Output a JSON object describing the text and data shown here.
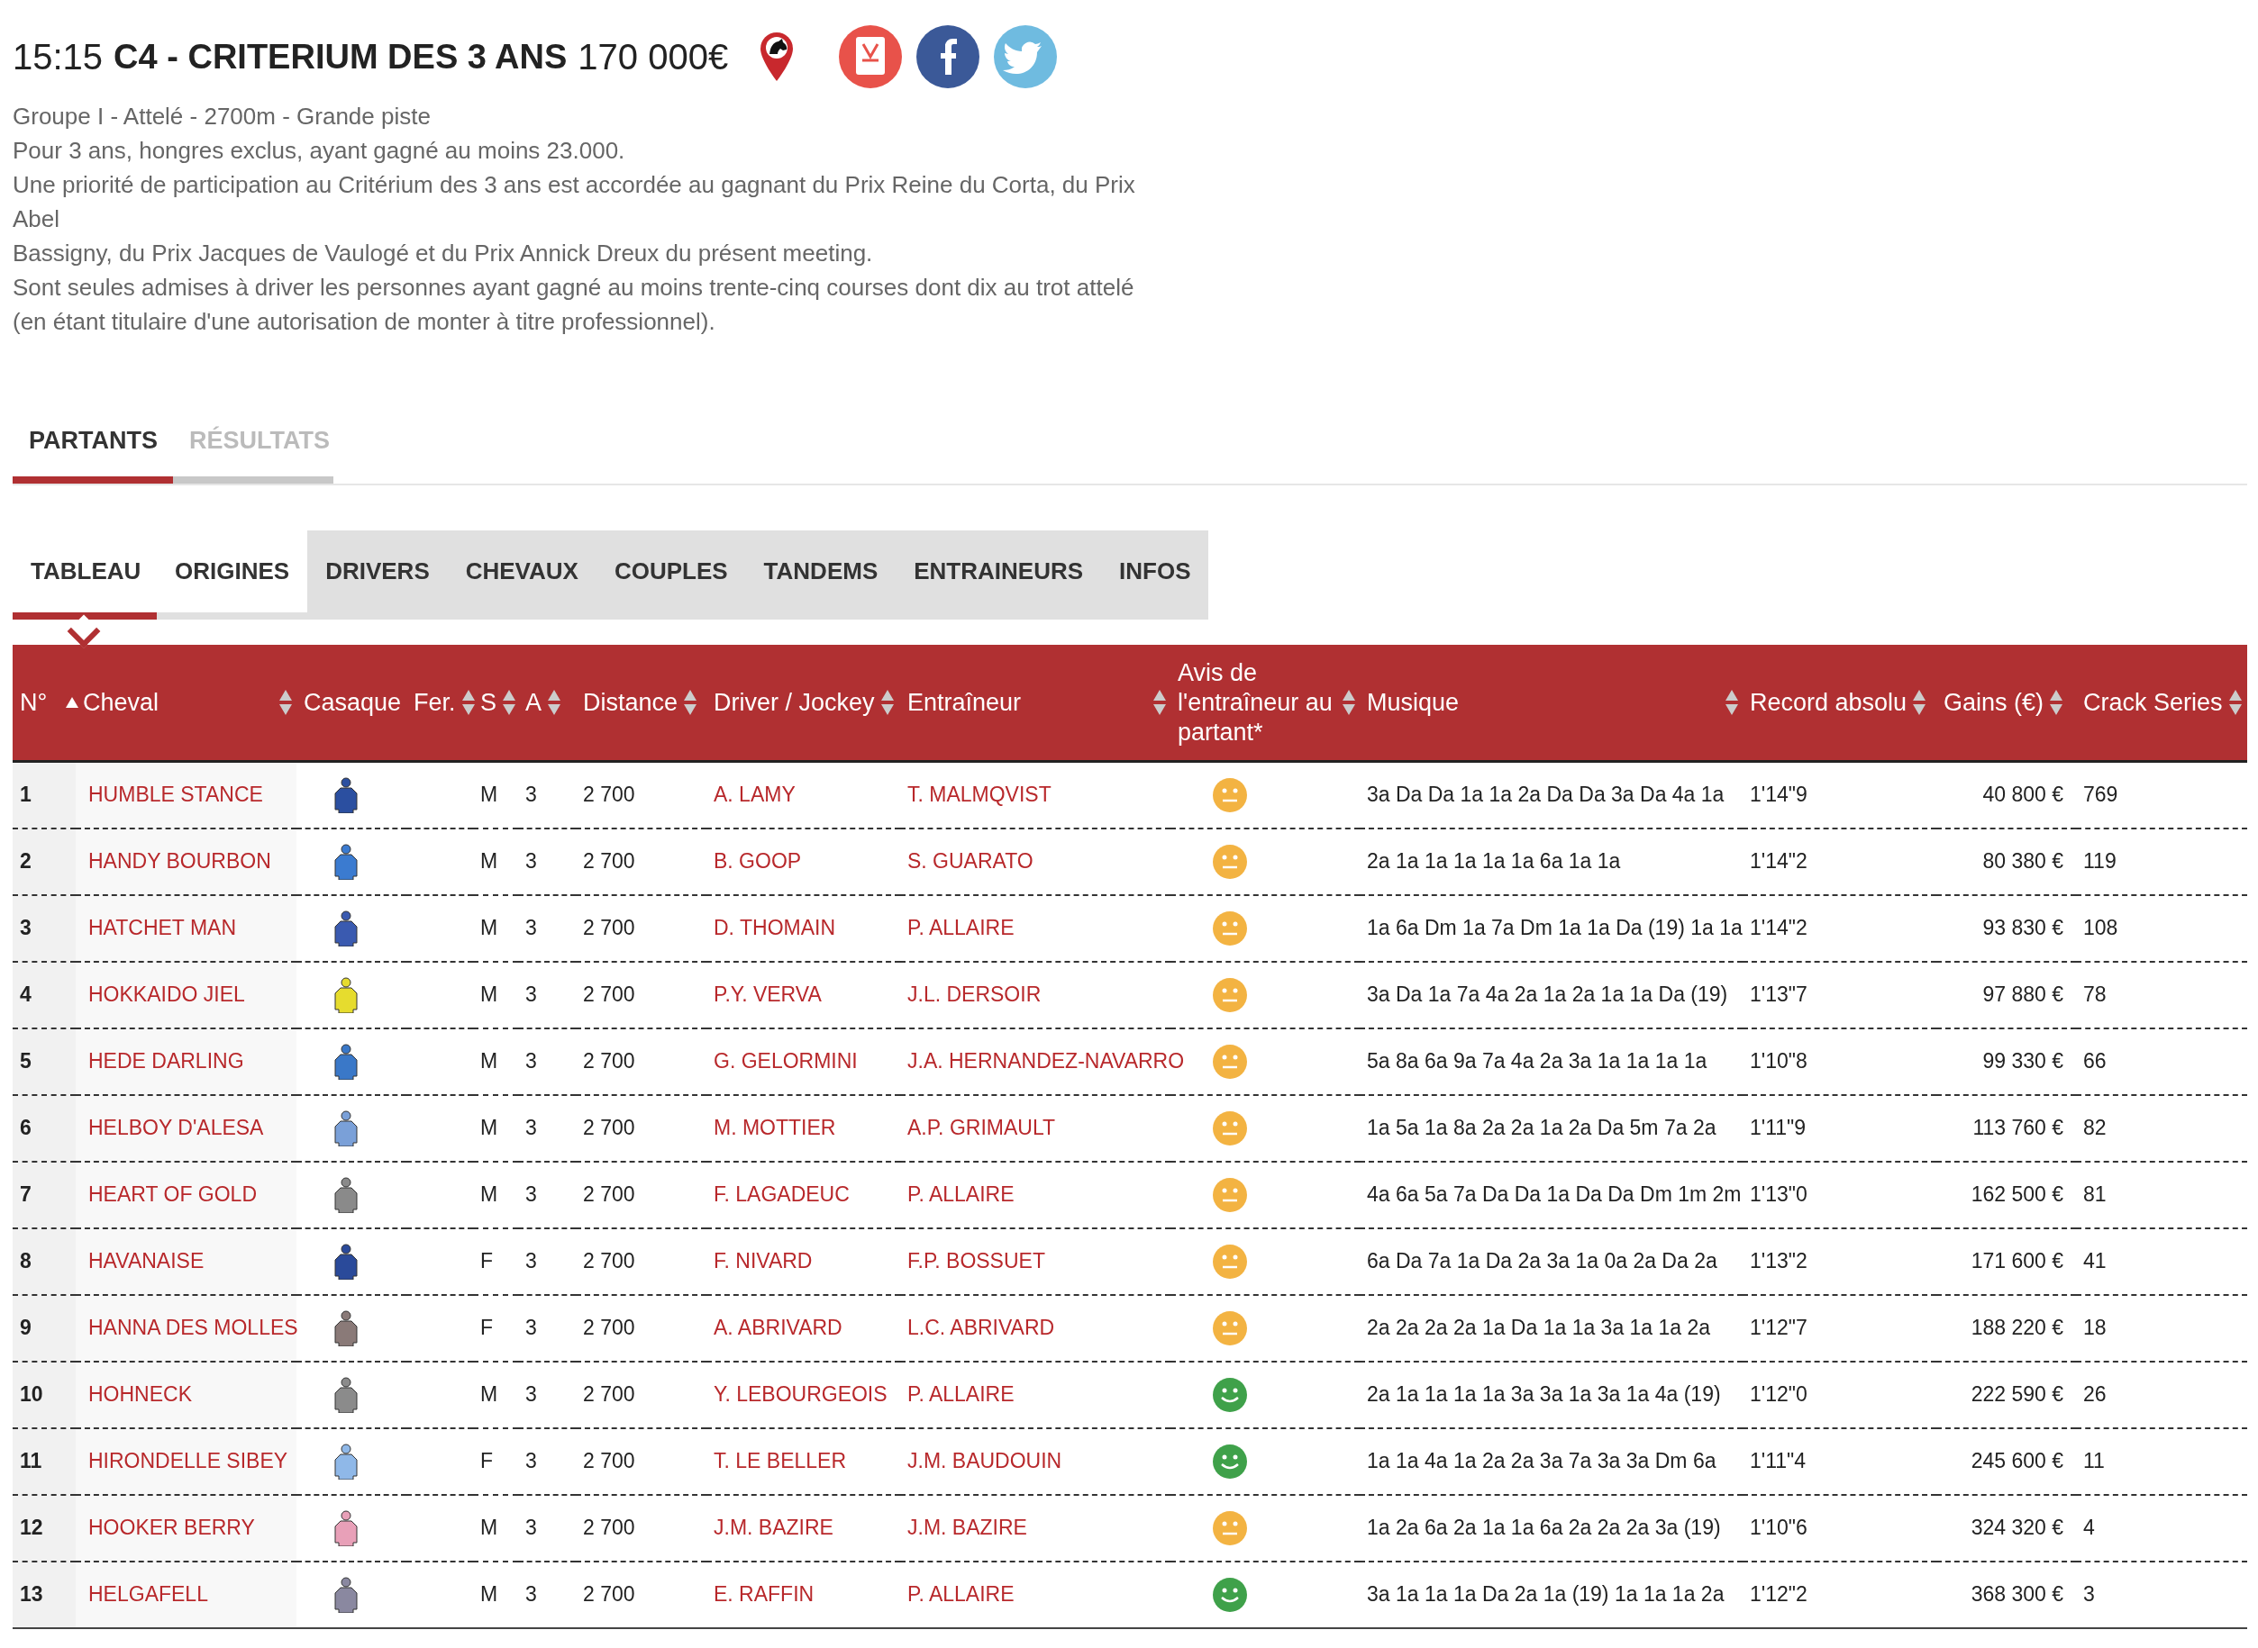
{
  "race": {
    "time": "15:15",
    "title": "C4 - CRITERIUM DES 3 ANS",
    "prize": "170 000€"
  },
  "description": [
    "Groupe I - Attelé - 2700m - Grande piste",
    "Pour 3 ans, hongres exclus, ayant gagné au moins 23.000.",
    "Une priorité de participation au Critérium des 3 ans est accordée au gagnant du Prix Reine du Corta, du Prix",
    "Abel",
    "Bassigny, du Prix Jacques de Vaulogé et du Prix Annick Dreux du présent meeting.",
    "Sont seules admises à driver les personnes ayant gagné au moins trente-cinq courses dont dix au trot attelé",
    "(en étant titulaire d'une autorisation de monter à titre professionnel)."
  ],
  "tabs": [
    {
      "label": "PARTANTS",
      "selected": true
    },
    {
      "label": "RÉSULTATS",
      "selected": false
    }
  ],
  "subtabs": [
    {
      "label": "TABLEAU",
      "selected": true,
      "shaded": false
    },
    {
      "label": "ORIGINES",
      "selected": false,
      "shaded": false
    },
    {
      "label": "DRIVERS",
      "selected": false,
      "shaded": true
    },
    {
      "label": "CHEVAUX",
      "selected": false,
      "shaded": true
    },
    {
      "label": "COUPLES",
      "selected": false,
      "shaded": true
    },
    {
      "label": "TANDEMS",
      "selected": false,
      "shaded": true
    },
    {
      "label": "ENTRAINEURS",
      "selected": false,
      "shaded": true
    },
    {
      "label": "INFOS",
      "selected": false,
      "shaded": true
    }
  ],
  "table": {
    "columns": [
      {
        "label": "N°",
        "sortable": true,
        "sorted_ascending": true
      },
      {
        "label": "Cheval",
        "sortable": true,
        "sorted_ascending": false
      },
      {
        "label": "Casaque",
        "sortable": false
      },
      {
        "label": "Fer.",
        "sortable": true,
        "sorted_ascending": false
      },
      {
        "label": "S",
        "sortable": true,
        "sorted_ascending": false
      },
      {
        "label": "A",
        "sortable": true,
        "sorted_ascending": false
      },
      {
        "label": "Distance",
        "sortable": true,
        "sorted_ascending": false
      },
      {
        "label": "Driver / Jockey",
        "sortable": true,
        "sorted_ascending": false
      },
      {
        "label": "Entraîneur",
        "sortable": true,
        "sorted_ascending": false
      },
      {
        "label": "Avis de l'entraîneur au partant*",
        "sortable": true,
        "sorted_ascending": false
      },
      {
        "label": "Musique",
        "sortable": true,
        "sorted_ascending": false
      },
      {
        "label": "Record absolu",
        "sortable": true,
        "sorted_ascending": false
      },
      {
        "label": "Gains (€)",
        "sortable": true,
        "sorted_ascending": false
      },
      {
        "label": "Crack Series",
        "sortable": true,
        "sorted_ascending": false
      }
    ],
    "rows": [
      {
        "num": "1",
        "horse": "HUMBLE STANCE",
        "color": "#2b4fa0",
        "sex": "M",
        "age": "3",
        "distance": "2 700",
        "driver": "A. LAMY",
        "trainer": "T. MALMQVIST",
        "avis_positive": false,
        "musique": "3a Da Da 1a 1a 2a Da Da 3a Da 4a 1a",
        "record": "1'14\"9",
        "gains": "40 800 €",
        "crack": "769"
      },
      {
        "num": "2",
        "horse": "HANDY BOURBON",
        "color": "#3b7bd0",
        "sex": "M",
        "age": "3",
        "distance": "2 700",
        "driver": "B. GOOP",
        "trainer": "S. GUARATO",
        "avis_positive": false,
        "musique": "2a 1a 1a 1a 1a 1a 6a 1a 1a",
        "record": "1'14\"2",
        "gains": "80 380 €",
        "crack": "119"
      },
      {
        "num": "3",
        "horse": "HATCHET MAN",
        "color": "#3a5ab0",
        "sex": "M",
        "age": "3",
        "distance": "2 700",
        "driver": "D. THOMAIN",
        "trainer": "P. ALLAIRE",
        "avis_positive": false,
        "musique": "1a 6a Dm 1a 7a Dm 1a 1a Da (19) 1a 1a",
        "record": "1'14\"2",
        "gains": "93 830 €",
        "crack": "108"
      },
      {
        "num": "4",
        "horse": "HOKKAIDO JIEL",
        "color": "#e6dc2e",
        "sex": "M",
        "age": "3",
        "distance": "2 700",
        "driver": "P.Y. VERVA",
        "trainer": "J.L. DERSOIR",
        "avis_positive": false,
        "musique": "3a Da 1a 7a 4a 2a 1a 2a 1a 1a Da (19)",
        "record": "1'13\"7",
        "gains": "97 880 €",
        "crack": "78"
      },
      {
        "num": "5",
        "horse": "HEDE DARLING",
        "color": "#3a78c8",
        "sex": "M",
        "age": "3",
        "distance": "2 700",
        "driver": "G. GELORMINI",
        "trainer": "J.A. HERNANDEZ-NAVARRO",
        "avis_positive": false,
        "musique": "5a 8a 6a 9a 7a 4a 2a 3a 1a 1a 1a 1a",
        "record": "1'10\"8",
        "gains": "99 330 €",
        "crack": "66"
      },
      {
        "num": "6",
        "horse": "HELBOY D'ALESA",
        "color": "#7aa0d8",
        "sex": "M",
        "age": "3",
        "distance": "2 700",
        "driver": "M. MOTTIER",
        "trainer": "A.P. GRIMAULT",
        "avis_positive": false,
        "musique": "1a 5a 1a 8a 2a 2a 1a 2a Da 5m 7a 2a",
        "record": "1'11\"9",
        "gains": "113 760 €",
        "crack": "82"
      },
      {
        "num": "7",
        "horse": "HEART OF GOLD",
        "color": "#8a8a8a",
        "sex": "M",
        "age": "3",
        "distance": "2 700",
        "driver": "F. LAGADEUC",
        "trainer": "P. ALLAIRE",
        "avis_positive": false,
        "musique": "4a 6a 5a 7a Da Da 1a Da Da Dm 1m 2m",
        "record": "1'13\"0",
        "gains": "162 500 €",
        "crack": "81"
      },
      {
        "num": "8",
        "horse": "HAVANAISE",
        "color": "#2a4a9a",
        "sex": "F",
        "age": "3",
        "distance": "2 700",
        "driver": "F. NIVARD",
        "trainer": "F.P. BOSSUET",
        "avis_positive": false,
        "musique": "6a Da 7a 1a Da 2a 3a 1a 0a 2a Da 2a",
        "record": "1'13\"2",
        "gains": "171 600 €",
        "crack": "41"
      },
      {
        "num": "9",
        "horse": "HANNA DES MOLLES",
        "color": "#8a7a78",
        "sex": "F",
        "age": "3",
        "distance": "2 700",
        "driver": "A. ABRIVARD",
        "trainer": "L.C. ABRIVARD",
        "avis_positive": false,
        "musique": "2a 2a 2a 2a 1a Da 1a 1a 3a 1a 1a 2a",
        "record": "1'12\"7",
        "gains": "188 220 €",
        "crack": "18"
      },
      {
        "num": "10",
        "horse": "HOHNECK",
        "color": "#8b8b8b",
        "sex": "M",
        "age": "3",
        "distance": "2 700",
        "driver": "Y. LEBOURGEOIS",
        "trainer": "P. ALLAIRE",
        "avis_positive": true,
        "musique": "2a 1a 1a 1a 1a 3a 3a 1a 3a 1a 4a (19)",
        "record": "1'12\"0",
        "gains": "222 590 €",
        "crack": "26"
      },
      {
        "num": "11",
        "horse": "HIRONDELLE SIBEY",
        "color": "#8fb8e8",
        "sex": "F",
        "age": "3",
        "distance": "2 700",
        "driver": "T. LE BELLER",
        "trainer": "J.M. BAUDOUIN",
        "avis_positive": true,
        "musique": "1a 1a 4a 1a 2a 2a 3a 7a 3a 3a Dm 6a",
        "record": "1'11\"4",
        "gains": "245 600 €",
        "crack": "11"
      },
      {
        "num": "12",
        "horse": "HOOKER BERRY",
        "color": "#e8a0b8",
        "sex": "M",
        "age": "3",
        "distance": "2 700",
        "driver": "J.M. BAZIRE",
        "trainer": "J.M. BAZIRE",
        "avis_positive": false,
        "musique": "1a 2a 6a 2a 1a 1a 6a 2a 2a 2a 3a (19)",
        "record": "1'10\"6",
        "gains": "324 320 €",
        "crack": "4"
      },
      {
        "num": "13",
        "horse": "HELGAFELL",
        "color": "#8a88a0",
        "sex": "M",
        "age": "3",
        "distance": "2 700",
        "driver": "E. RAFFIN",
        "trainer": "P. ALLAIRE",
        "avis_positive": true,
        "musique": "3a 1a 1a 1a Da 2a 1a (19) 1a 1a 1a 2a",
        "record": "1'12\"2",
        "gains": "368 300 €",
        "crack": "3"
      }
    ]
  }
}
